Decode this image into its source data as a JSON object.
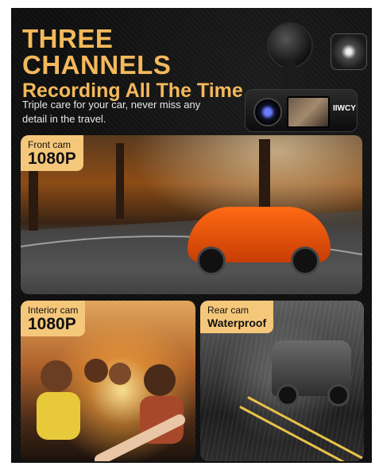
{
  "headline": {
    "line1": "THREE CHANNELS",
    "line2": "Recording All The Time"
  },
  "subtitle": "Triple care for your car, never miss any detail in the travel.",
  "device": {
    "brand_mark": "IIWCY"
  },
  "panels": {
    "front": {
      "label": "Front cam",
      "resolution": "1080P"
    },
    "interior": {
      "label": "Interior cam",
      "resolution": "1080P"
    },
    "rear": {
      "label": "Rear cam",
      "feature": "Waterproof"
    }
  },
  "colors": {
    "accent": "#f4b95b",
    "label_bg": "#f5c77a",
    "background": "#0f0f0f"
  }
}
